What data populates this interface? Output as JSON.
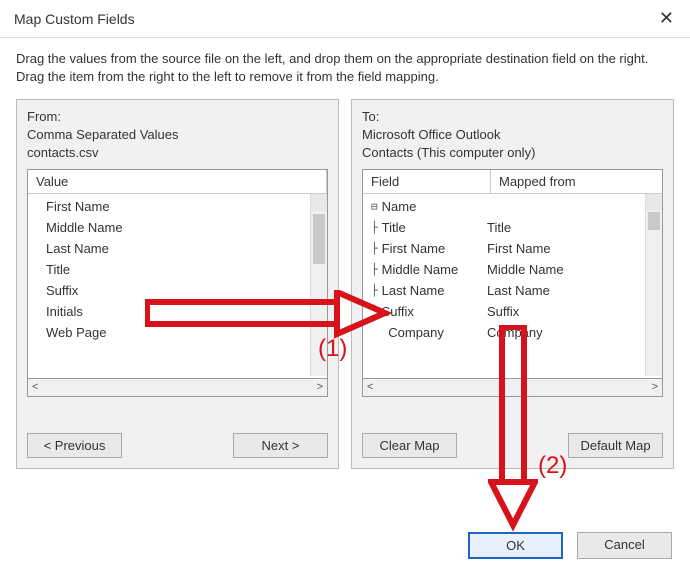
{
  "window": {
    "title": "Map Custom Fields",
    "close_glyph": "✕"
  },
  "instructions": "Drag the values from the source file on the left, and drop them on the appropriate destination field on the right.  Drag the item from the right to the left to remove it from the field mapping.",
  "from": {
    "label": "From:",
    "line1": "Comma Separated Values",
    "line2": "contacts.csv",
    "column_header": "Value",
    "items": [
      "First Name",
      "Middle Name",
      "Last Name",
      "Title",
      "Suffix",
      "Initials",
      "Web Page"
    ]
  },
  "to": {
    "label": "To:",
    "line1": "Microsoft Office Outlook",
    "line2": "Contacts (This computer only)",
    "col_field": "Field",
    "col_mapped": "Mapped from",
    "root": {
      "glyph": "⊟",
      "label": "Name"
    },
    "items": [
      {
        "field": "Title",
        "mapped": "Title"
      },
      {
        "field": "First Name",
        "mapped": "First Name"
      },
      {
        "field": "Middle Name",
        "mapped": "Middle Name"
      },
      {
        "field": "Last Name",
        "mapped": "Last Name"
      },
      {
        "field": "Suffix",
        "mapped": "Suffix"
      },
      {
        "field": "Company",
        "mapped": "Company"
      }
    ]
  },
  "buttons": {
    "previous": "< Previous",
    "next": "Next >",
    "clear_map": "Clear Map",
    "default_map": "Default Map",
    "ok": "OK",
    "cancel": "Cancel"
  },
  "annot": {
    "step1": "(1)",
    "step2": "(2)"
  },
  "scroll": {
    "left": "<",
    "right": ">",
    "up": "∧"
  }
}
